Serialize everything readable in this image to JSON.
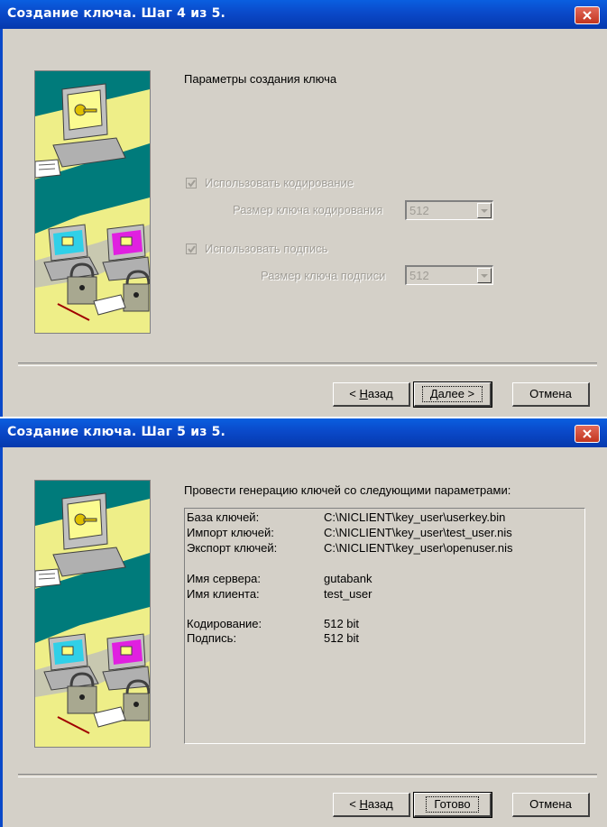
{
  "step4": {
    "title": "Создание ключа. Шаг 4 из 5.",
    "heading": "Параметры создания ключа",
    "use_encryption": {
      "label": "Использовать кодирование",
      "checked": true,
      "enabled": false
    },
    "encryption_key_size": {
      "label": "Размер ключа кодирования",
      "value": "512"
    },
    "use_signature": {
      "label": "Использовать подпись",
      "checked": true,
      "enabled": false
    },
    "signature_key_size": {
      "label": "Размер ключа подписи",
      "value": "512"
    },
    "buttons": {
      "back_prefix": "< ",
      "back_mnemonic": "Н",
      "back_rest": "азад",
      "next_mnemonic": "Д",
      "next_rest": "алее >",
      "cancel": "Отмена"
    }
  },
  "step5": {
    "title": "Создание ключа. Шаг 5 из 5.",
    "heading": "Провести генерацию ключей со следующими параметрами:",
    "params": [
      {
        "key": "База ключей:",
        "value": "C:\\NICLIENT\\key_user\\userkey.bin"
      },
      {
        "key": "Импорт ключей:",
        "value": "C:\\NICLIENT\\key_user\\test_user.nis"
      },
      {
        "key": "Экспорт ключей:",
        "value": "C:\\NICLIENT\\key_user\\openuser.nis"
      },
      {
        "key": "Имя сервера:",
        "value": "gutabank"
      },
      {
        "key": "Имя клиента:",
        "value": "test_user"
      },
      {
        "key": "Кодирование:",
        "value": "512 bit"
      },
      {
        "key": "Подпись:",
        "value": "512 bit"
      }
    ],
    "buttons": {
      "back_prefix": "< ",
      "back_mnemonic": "Н",
      "back_rest": "азад",
      "finish": "Готово",
      "cancel": "Отмена"
    }
  },
  "icons": [
    "close-icon",
    "wizard-illustration",
    "checkmark-icon",
    "dropdown-arrow-icon"
  ],
  "colors": {
    "titlebar": "#0a49c9",
    "dialog_bg": "#d4d0c8",
    "art_teal": "#007b7b",
    "art_yellow": "#eeee88",
    "close_red": "#c2351f"
  }
}
